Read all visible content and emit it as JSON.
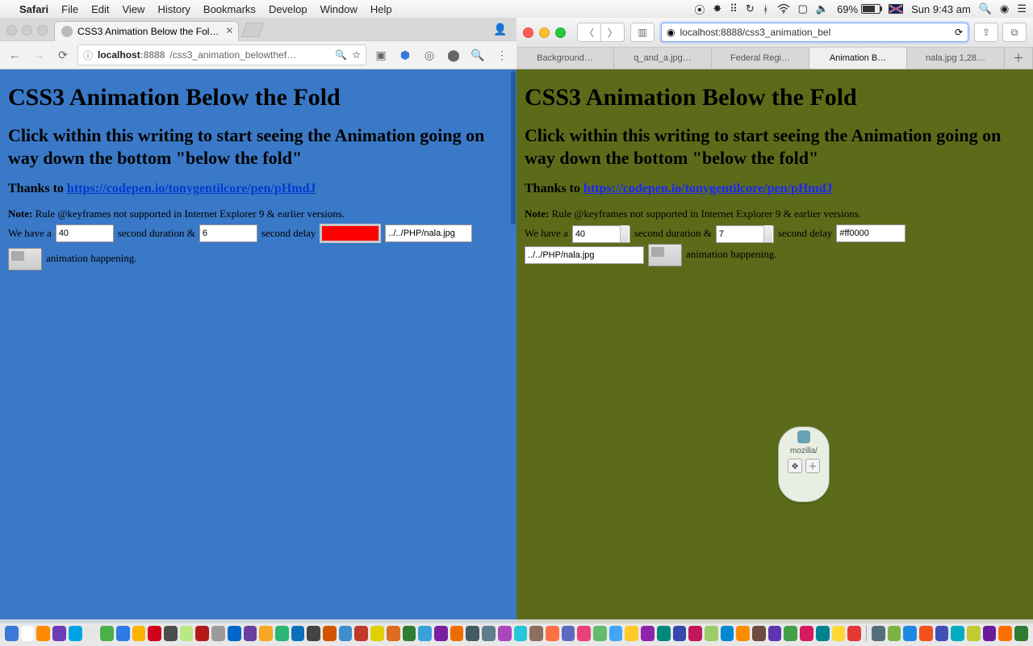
{
  "menubar": {
    "app": "Safari",
    "menus": [
      "File",
      "Edit",
      "View",
      "History",
      "Bookmarks",
      "Develop",
      "Window",
      "Help"
    ],
    "battery_pct": "69%",
    "clock": "Sun 9:43 am"
  },
  "chrome": {
    "tab_title": "CSS3 Animation Below the Fol…",
    "url_host": "localhost",
    "url_port": ":8888",
    "url_path": "/css3_animation_belowthef…"
  },
  "safari": {
    "url": "localhost:8888/css3_animation_bel",
    "tabs": [
      "Background…",
      "q_and_a.jpg…",
      "Federal Regi…",
      "Animation B…",
      "nala.jpg 1,28…"
    ],
    "active_tab_index": 3
  },
  "left_page": {
    "h1": "CSS3 Animation Below the Fold",
    "h2": "Click within this writing to start seeing the Animation going on way down the bottom \"below the fold\"",
    "thanks_prefix": "Thanks to ",
    "thanks_link": "https://codepen.io/tonygentilcore/pen/pHmdJ",
    "note_label": "Note:",
    "note_text": " Rule @keyframes not supported in Internet Explorer 9 & earlier versions.",
    "t_wehavea": "We have a",
    "duration_val": "40",
    "t_seconddur": "second duration &",
    "delay_val": "6",
    "t_seconddel": "second delay",
    "imgpath": "../../PHP/nala.jpg",
    "t_anim": "animation happening."
  },
  "right_page": {
    "h1": "CSS3 Animation Below the Fold",
    "h2": "Click within this writing to start seeing the Animation going on way down the bottom \"below the fold\"",
    "thanks_prefix": "Thanks to ",
    "thanks_link": "https://codepen.io/tonygentilcore/pen/pHmdJ",
    "note_label": "Note:",
    "note_text": " Rule @keyframes not supported in Internet Explorer 9 & earlier versions.",
    "t_wehavea": "We have a",
    "duration_val": "40",
    "t_seconddur": "second duration &",
    "delay_val": "7",
    "t_seconddel": "second delay",
    "color_hex": "#ff0000",
    "imgpath": "../../PHP/nala.jpg",
    "t_anim": "animation happening.",
    "widget_label": "mozilla/"
  },
  "dock_colors": [
    "#3b78d8",
    "#ffffff",
    "#ff8a00",
    "#6c3db7",
    "#00a4e4",
    "#e5e5e5",
    "#49b04a",
    "#2c7be5",
    "#ffb300",
    "#d0021b",
    "#4d4d4d",
    "#b8e986",
    "#b31b1b",
    "#9b9b9b",
    "#0066cc",
    "#6b3fa0",
    "#f5a623",
    "#2bb673",
    "#0b72b9",
    "#444444",
    "#d35400",
    "#3f8ed0",
    "#c0392b",
    "#e0d000",
    "#dd6b20",
    "#2e7d32",
    "#38a1db",
    "#7b1fa2",
    "#ef6c00",
    "#455a64",
    "#607d8b",
    "#ab47bc",
    "#26c6da",
    "#8d6e63",
    "#ff7043",
    "#5c6bc0",
    "#ec407a",
    "#66bb6a",
    "#42a5f5",
    "#ffca28",
    "#8e24aa",
    "#00897b",
    "#3949ab",
    "#c2185b",
    "#9ccc65",
    "#0288d1",
    "#fb8c00",
    "#6d4c41",
    "#5e35b1",
    "#43a047",
    "#d81b60",
    "#00838f",
    "#fdd835",
    "#e53935",
    "#546e7a",
    "#7cb342",
    "#1e88e5",
    "#f4511e",
    "#3f51b5",
    "#00acc1",
    "#c0ca33",
    "#6a1b9a",
    "#ff6f00",
    "#2e7d32"
  ]
}
